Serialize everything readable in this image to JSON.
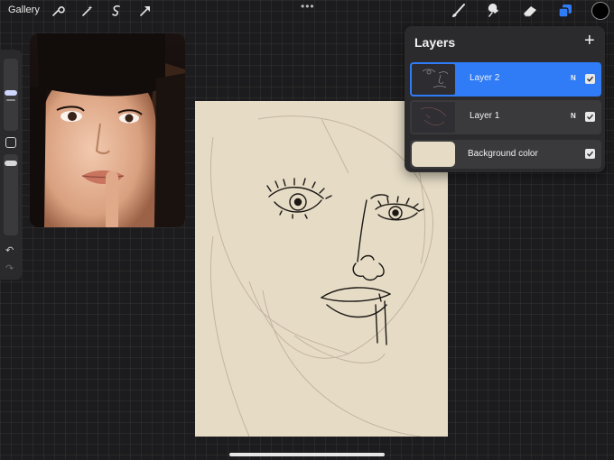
{
  "topbar": {
    "gallery_label": "Gallery",
    "left_tools": [
      "wrench-icon",
      "magic-wand-icon",
      "selection-icon",
      "transform-arrow-icon"
    ],
    "menu_dots": "•••",
    "right_tools": [
      "brush-icon",
      "smudge-icon",
      "eraser-icon",
      "layers-icon"
    ],
    "current_color": "#000000",
    "accent_color": "#2f7cf6"
  },
  "sidebar": {
    "tools": [
      "brush-size-slider",
      "modify-button",
      "opacity-slider",
      "undo-icon",
      "redo-icon"
    ],
    "undo_glyph": "↶",
    "redo_glyph": "↷"
  },
  "layers_panel": {
    "title": "Layers",
    "add_glyph": "+",
    "layers": [
      {
        "name": "Layer 2",
        "blend_mode": "N",
        "visible": true,
        "selected": true
      },
      {
        "name": "Layer 1",
        "blend_mode": "N",
        "visible": true,
        "selected": false
      }
    ],
    "background": {
      "name": "Background color",
      "color": "#e6dcc6",
      "visible": true
    }
  },
  "canvas": {
    "paper_color": "#e6dcc6"
  }
}
